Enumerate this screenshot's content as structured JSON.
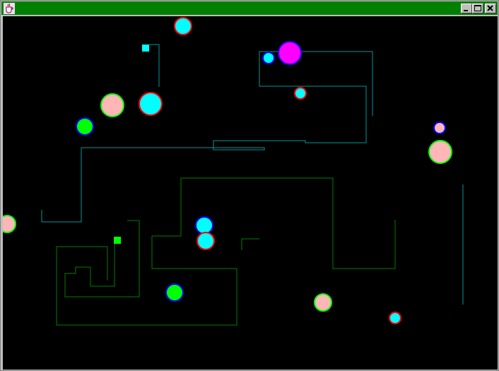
{
  "window": {
    "title": "",
    "icon": "java-coffee-cup-icon",
    "buttons": [
      {
        "name": "minimize-button",
        "icon": "minimize-icon"
      },
      {
        "name": "maximize-button",
        "icon": "maximize-icon"
      },
      {
        "name": "close-button",
        "icon": "close-icon"
      }
    ],
    "title_bar_color": "#008000"
  },
  "game": {
    "background_color": "#000000",
    "colors": {
      "cyan": "#00ffff",
      "pink": "#ffb6b6",
      "green": "#00ff00",
      "magenta": "#ff00ff",
      "ring_red": "#ff0000",
      "ring_blue": "#0000ff",
      "ring_green": "#00ff00",
      "ring_violet": "#2a00ff",
      "trail_teal": "#009999",
      "trail_green": "#008000"
    },
    "players": [
      {
        "id": "cyan-player",
        "color": "cyan"
      },
      {
        "id": "green-player",
        "color": "green"
      }
    ],
    "balls": [
      {
        "fill": "cyan",
        "ring": "ring_red",
        "size": "medium"
      },
      {
        "fill": "magenta",
        "ring": "ring_violet",
        "size": "large"
      },
      {
        "fill": "cyan",
        "ring": "ring_blue",
        "size": "small"
      },
      {
        "fill": "cyan",
        "ring": "ring_red",
        "size": "small"
      },
      {
        "fill": "pink",
        "ring": "ring_green",
        "size": "large"
      },
      {
        "fill": "cyan",
        "ring": "ring_red",
        "size": "large"
      },
      {
        "fill": "green",
        "ring": "ring_blue",
        "size": "medium"
      },
      {
        "fill": "pink",
        "ring": "ring_blue",
        "size": "small"
      },
      {
        "fill": "pink",
        "ring": "ring_green",
        "size": "large"
      },
      {
        "fill": "pink",
        "ring": "ring_green",
        "size": "medium"
      },
      {
        "fill": "cyan",
        "ring": "ring_blue",
        "size": "medium"
      },
      {
        "fill": "cyan",
        "ring": "ring_red",
        "size": "medium"
      },
      {
        "fill": "green",
        "ring": "ring_blue",
        "size": "medium"
      },
      {
        "fill": "pink",
        "ring": "ring_green",
        "size": "medium"
      },
      {
        "fill": "cyan",
        "ring": "ring_red",
        "size": "small"
      }
    ]
  }
}
